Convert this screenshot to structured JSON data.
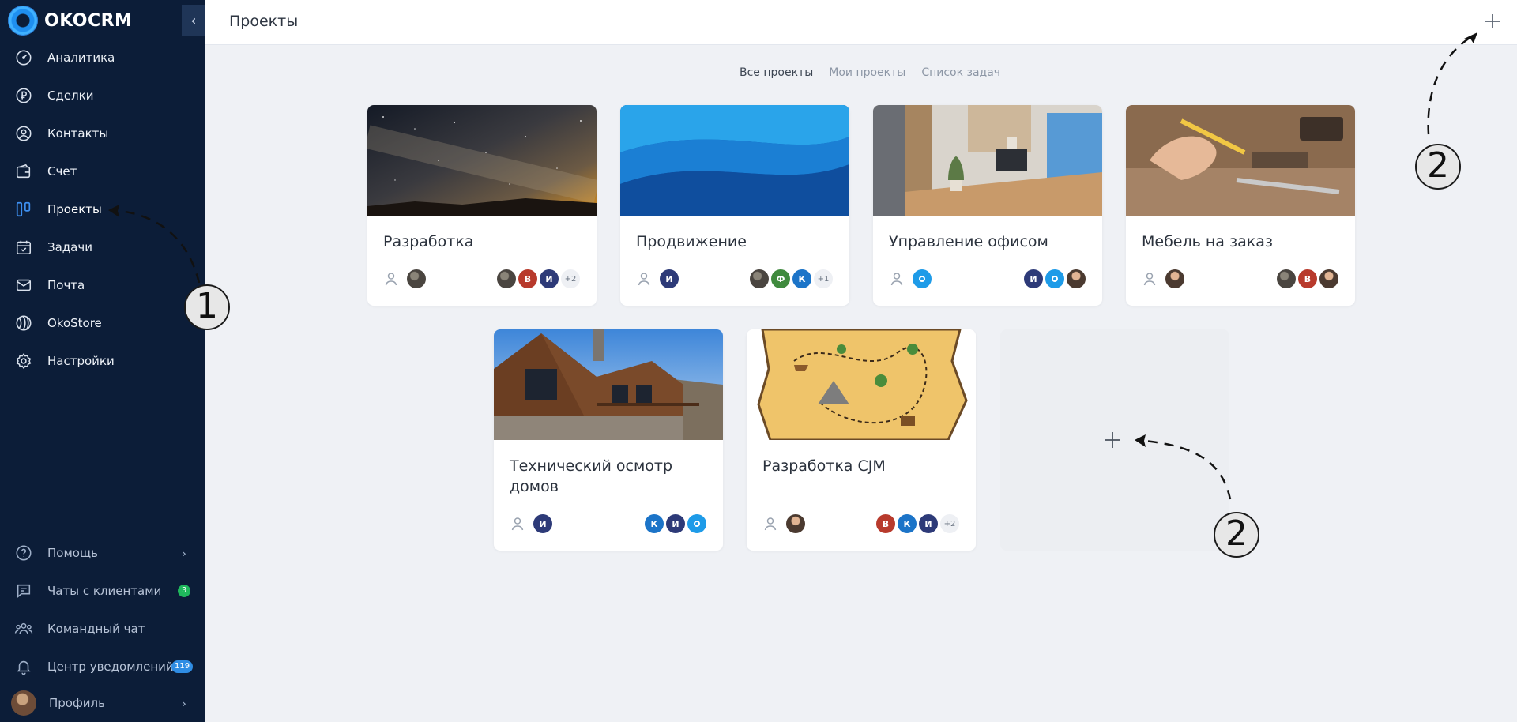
{
  "app": {
    "logo_text": "OKOCRM"
  },
  "sidebar": {
    "items": [
      {
        "label": "Аналитика",
        "icon": "analytics-gauge-icon"
      },
      {
        "label": "Сделки",
        "icon": "ruble-icon"
      },
      {
        "label": "Контакты",
        "icon": "contact-icon"
      },
      {
        "label": "Счет",
        "icon": "wallet-icon"
      },
      {
        "label": "Проекты",
        "icon": "kanban-icon",
        "active": true
      },
      {
        "label": "Задачи",
        "icon": "calendar-check-icon"
      },
      {
        "label": "Почта",
        "icon": "mail-icon"
      },
      {
        "label": "OkoStore",
        "icon": "store-icon"
      },
      {
        "label": "Настройки",
        "icon": "gear-icon"
      }
    ],
    "bottom": [
      {
        "label": "Помощь",
        "icon": "help-icon"
      },
      {
        "label": "Чаты с клиентами",
        "icon": "chat-icon",
        "badge": "3"
      },
      {
        "label": "Командный чат",
        "icon": "team-icon"
      },
      {
        "label": "Центр уведомлений",
        "icon": "bell-icon",
        "badge": "119"
      },
      {
        "label": "Профиль",
        "icon": "avatar-icon"
      }
    ]
  },
  "header": {
    "title": "Проекты"
  },
  "filters": [
    "Все проекты",
    "Мои проекты",
    "Список задач"
  ],
  "projects": [
    {
      "title": "Разработка",
      "members": [
        "",
        "В",
        "И",
        "+2"
      ]
    },
    {
      "title": "Продвижение",
      "owner": "И",
      "members": [
        "",
        "Ф",
        "К",
        "+1"
      ]
    },
    {
      "title": "Управление офисом",
      "members": [
        "И",
        "",
        ""
      ]
    },
    {
      "title": "Мебель на заказ",
      "members": [
        "",
        "В",
        ""
      ]
    },
    {
      "title": "Технический осмотр домов",
      "owner": "И",
      "members": [
        "К",
        "И",
        ""
      ]
    },
    {
      "title": "Разработка CJM",
      "members": [
        "В",
        "К",
        "И",
        "+2"
      ]
    }
  ],
  "annotations": [
    "1",
    "2",
    "2"
  ],
  "colors": {
    "sidebar_bg": "#0c1d38",
    "active_blue": "#3d8ff0",
    "badge_green": "#1fb85c",
    "badge_blue": "#2f8de4",
    "avatar_navy": "#2d3a78",
    "avatar_red": "#b83a2c",
    "avatar_green": "#3f8a3d",
    "avatar_blue": "#1c74c8",
    "avatar_cyan": "#1e9be8"
  }
}
